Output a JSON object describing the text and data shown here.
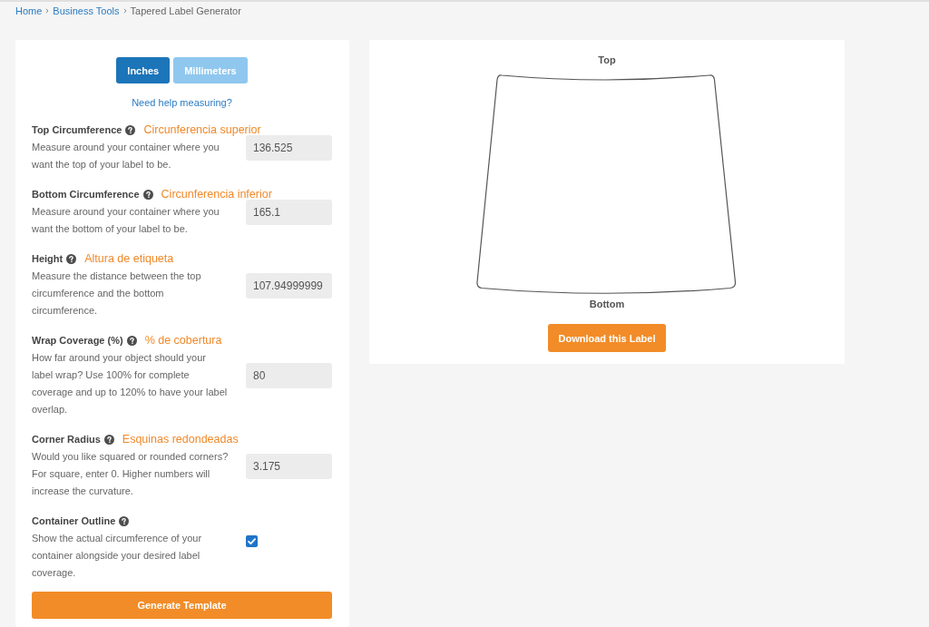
{
  "breadcrumb": [
    {
      "label": "Home",
      "current": false
    },
    {
      "label": "Business Tools",
      "current": false
    },
    {
      "label": "Tapered Label Generator",
      "current": true
    }
  ],
  "unit_toggle": [
    {
      "label": "Inches",
      "selected": true
    },
    {
      "label": "Millimeters",
      "selected": false
    }
  ],
  "help_link": "Need help measuring?",
  "fields": [
    {
      "kind": "number",
      "label": "Top Circumference",
      "annotation": "Circunferencia superior",
      "description": [
        "Measure around your container where you",
        "want the top of your label to be."
      ],
      "value": "136.525"
    },
    {
      "kind": "number",
      "label": "Bottom Circumference",
      "annotation": "Circunferencia inferior",
      "description": [
        "Measure around your container where you",
        "want the bottom of your label to be."
      ],
      "value": "165.1"
    },
    {
      "kind": "number",
      "label": "Height",
      "annotation": "Altura de etiqueta",
      "description": [
        "Measure the distance between the top",
        "circumference and the bottom",
        "circumference."
      ],
      "value": "107.94999999"
    },
    {
      "kind": "number",
      "label": "Wrap Coverage (%)",
      "annotation": "% de cobertura",
      "description": [
        "How far around your object should your",
        "label wrap? Use 100% for complete",
        "coverage and up to 120% to have your label",
        "overlap."
      ],
      "value": "80"
    },
    {
      "kind": "number",
      "label": "Corner Radius",
      "annotation": "Esquinas redondeadas",
      "description": [
        "Would you like squared or rounded corners?",
        "For square, enter 0. Higher numbers will",
        "increase the curvature."
      ],
      "value": "3.175"
    },
    {
      "kind": "checkbox",
      "label": "Container Outline",
      "description": [
        "Show the actual circumference of your",
        "container alongside your desired label",
        "coverage."
      ],
      "checked": true
    }
  ],
  "generate_button": "Generate Template",
  "preview": {
    "top_label": "Top",
    "bottom_label": "Bottom",
    "download_button": "Download this Label"
  }
}
